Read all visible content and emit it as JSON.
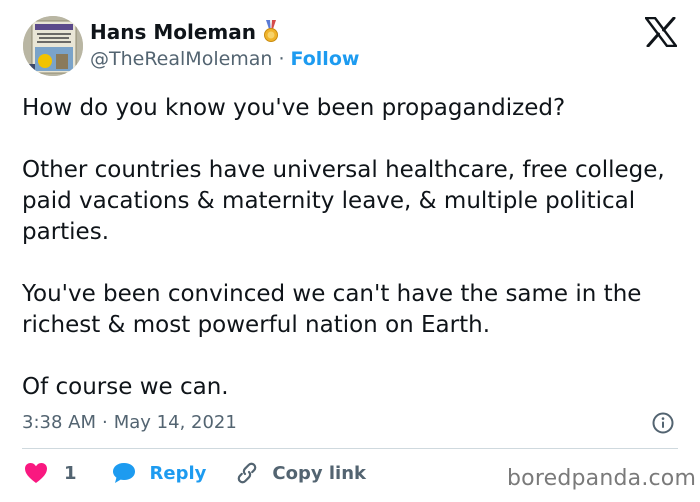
{
  "author": {
    "display_name": "Hans Moleman",
    "handle": "@TheRealMoleman",
    "separator": "·",
    "follow_label": "Follow"
  },
  "avatar": {
    "cover_text": "",
    "frame_color": "#c9c6b6"
  },
  "icons": {
    "verified": "medal-icon",
    "platform": "x-logo-icon",
    "info": "info-icon",
    "like": "heart-icon",
    "reply": "speech-bubble-icon",
    "copy": "link-icon"
  },
  "tweet": {
    "paragraphs": [
      "How do you know you've been propagandized?",
      "Other countries have universal healthcare, free college, paid vacations & maternity leave, & multiple political parties.",
      "You've been convinced we can't have the same in the richest & most powerful nation on Earth.",
      "Of course we can."
    ],
    "time": "3:38 AM",
    "date_separator": "·",
    "date": "May 14, 2021"
  },
  "actions": {
    "like_count": "1",
    "reply_label": "Reply",
    "copy_label": "Copy link"
  },
  "watermark": "boredpanda.com",
  "colors": {
    "text": "#0f1419",
    "secondary": "#536471",
    "accent": "#1d9bf0",
    "like": "#f91880",
    "divider": "#cfd9de"
  }
}
